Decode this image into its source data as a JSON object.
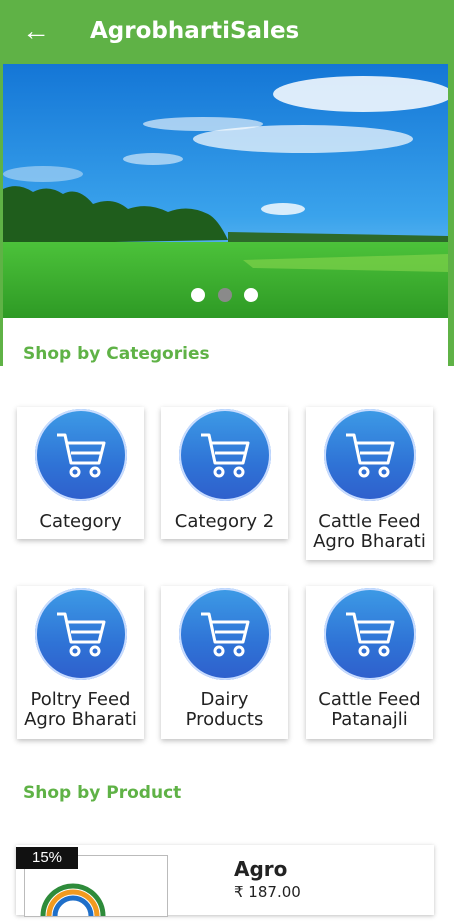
{
  "appbar": {
    "title": "AgrobhartiSales",
    "back_icon": "arrow-left-icon"
  },
  "banner": {
    "dots": 3,
    "active_dot": 1
  },
  "sections": {
    "categories": "Shop by Categories",
    "products": "Shop by Product"
  },
  "categories": [
    {
      "line1": "Category",
      "line2": ""
    },
    {
      "line1": "Category 2",
      "line2": ""
    },
    {
      "line1": "Cattle Feed",
      "line2": "Agro Bharati"
    },
    {
      "line1": "Poltry Feed",
      "line2": "Agro Bharati"
    },
    {
      "line1": "Dairy",
      "line2": "Products"
    },
    {
      "line1": "Cattle Feed",
      "line2": "Patanajli"
    }
  ],
  "product": {
    "badge": "15%",
    "name": "Agro",
    "price": "₹ 187.00"
  },
  "colors": {
    "accent": "#5fb246",
    "icon_circle": "#2f73d6"
  }
}
